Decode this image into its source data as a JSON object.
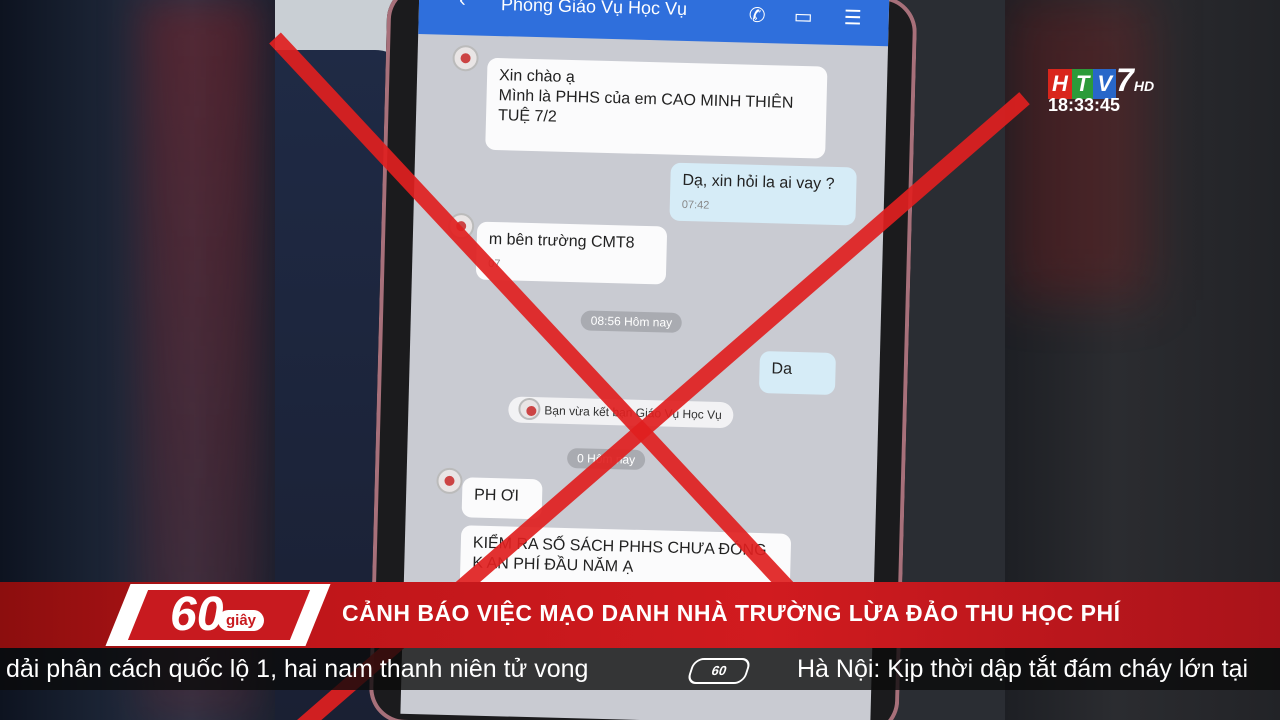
{
  "chat": {
    "contact_name": "Phòng Giáo Vụ Học Vụ",
    "messages": [
      {
        "text_line1": "Xin chào ạ",
        "text_line2": "Mình là PHHS của em CAO MINH THIÊN",
        "text_line3": "TUỆ 7/2"
      },
      {
        "text": "Dạ, xin hỏi la ai vay ?",
        "time": "07:42"
      },
      {
        "text": "m bên trường CMT8",
        "time": "07"
      },
      {
        "text": "Da"
      },
      {
        "text": "PH ƠI"
      },
      {
        "text_line1": "KIỂM  RA SỐ SÁCH PHHS CHƯA ĐÓNG",
        "text_line2": "K  AN PHÍ ĐẦU NĂM Ạ"
      }
    ],
    "separator1": "08:56 Hôm nay",
    "separator2": "0   Hôm nay",
    "notice": "Bạn vừa kết bạn  Giáo Vụ Học Vụ"
  },
  "broadcast": {
    "channel_logo": {
      "letters": [
        "H",
        "T",
        "V"
      ],
      "number": "7",
      "suffix": "HD"
    },
    "clock": "18:33:45",
    "program_badge": {
      "number": "60",
      "word": "giây"
    },
    "headline": "CẢNH BÁO VIỆC MẠO DANH NHÀ TRƯỜNG LỪA ĐẢO THU HỌC PHÍ",
    "ticker_left": "dải phân cách quốc lộ 1, hai nam thanh niên tử vong",
    "ticker_logo": "60",
    "ticker_right": "Hà Nội: Kịp thời dập tắt đám cháy lớn tại"
  },
  "colors": {
    "accent_red": "#d11b1f",
    "header_blue": "#2f6fdc"
  },
  "icons": [
    "back-arrow-icon",
    "phone-icon",
    "video-icon",
    "menu-icon"
  ]
}
